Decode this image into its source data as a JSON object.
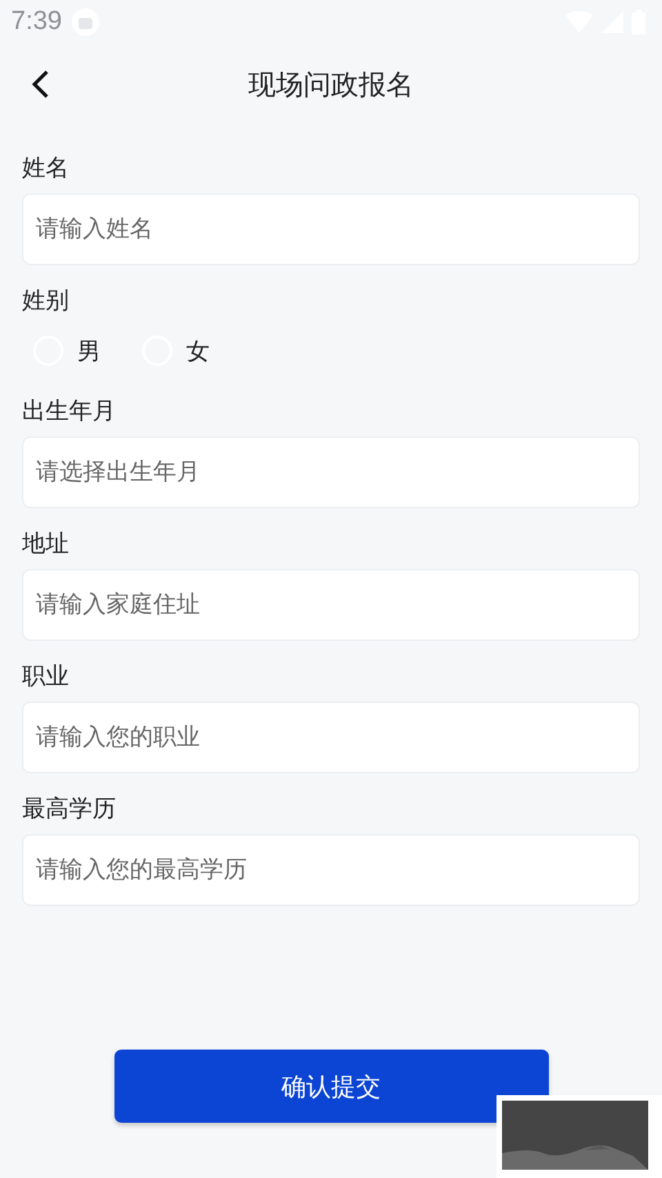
{
  "status_bar": {
    "time": "7:39"
  },
  "header": {
    "title": "现场问政报名"
  },
  "fields": [
    {
      "kind": "text",
      "label": "姓名",
      "placeholder": "请输入姓名"
    },
    {
      "kind": "radio",
      "label": "姓别",
      "options": [
        {
          "label": "男",
          "selected": false
        },
        {
          "label": "女",
          "selected": false
        }
      ]
    },
    {
      "kind": "text",
      "label": "出生年月",
      "placeholder": "请选择出生年月"
    },
    {
      "kind": "text",
      "label": "地址",
      "placeholder": "请输入家庭住址"
    },
    {
      "kind": "text",
      "label": "职业",
      "placeholder": "请输入您的职业"
    },
    {
      "kind": "text",
      "label": "最高学历",
      "placeholder": "请输入您的最高学历"
    }
  ],
  "submit_button": {
    "label": "确认提交"
  }
}
